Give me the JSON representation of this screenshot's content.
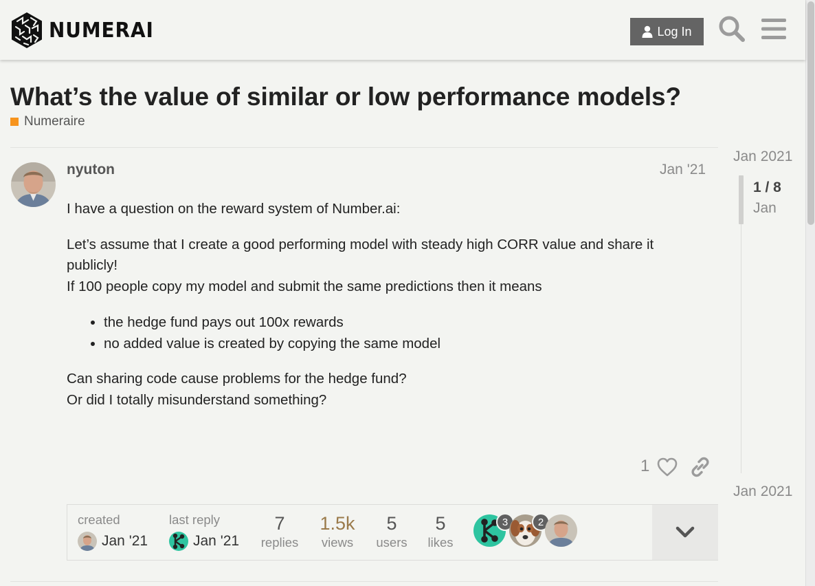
{
  "header": {
    "brand": "NUMERAI",
    "login_label": "Log In"
  },
  "topic": {
    "title": "What’s the value of similar or low performance models?",
    "category": "Numeraire",
    "category_color": "#f7941d"
  },
  "post": {
    "username": "nyuton",
    "date": "Jan '21",
    "paragraphs": [
      "I have a question on the reward system of Number.ai:",
      "Let’s assume that I create a good performing model with steady high CORR value and share it publicly!",
      "If 100 people copy my model and submit the same predictions then it means"
    ],
    "bullets": [
      "the hedge fund pays out 100x rewards",
      "no added value is created by copying the same model"
    ],
    "closing": [
      "Can sharing code cause problems for the hedge fund?",
      "Or did I totally misunderstand something?"
    ],
    "like_count": "1"
  },
  "topic_map": {
    "created_label": "created",
    "created_date": "Jan '21",
    "last_reply_label": "last reply",
    "last_reply_date": "Jan '21",
    "stats": [
      {
        "num": "7",
        "label": "replies"
      },
      {
        "num": "1.5k",
        "label": "views"
      },
      {
        "num": "5",
        "label": "users"
      },
      {
        "num": "5",
        "label": "likes"
      }
    ],
    "views_color": "#9a7a4a",
    "participants": [
      {
        "name": "numerai-k-avatar",
        "count": "3"
      },
      {
        "name": "dog-avatar",
        "count": "2"
      },
      {
        "name": "nyuton-avatar",
        "count": ""
      }
    ]
  },
  "timeline": {
    "top_date": "Jan 2021",
    "position": "1 / 8",
    "position_sub": "Jan",
    "bottom_date": "Jan 2021"
  },
  "icons": {
    "login": "user-icon",
    "search": "search-icon",
    "menu": "hamburger-menu-icon",
    "like": "heart-icon",
    "share": "link-icon",
    "expand": "chevron-down-icon"
  }
}
